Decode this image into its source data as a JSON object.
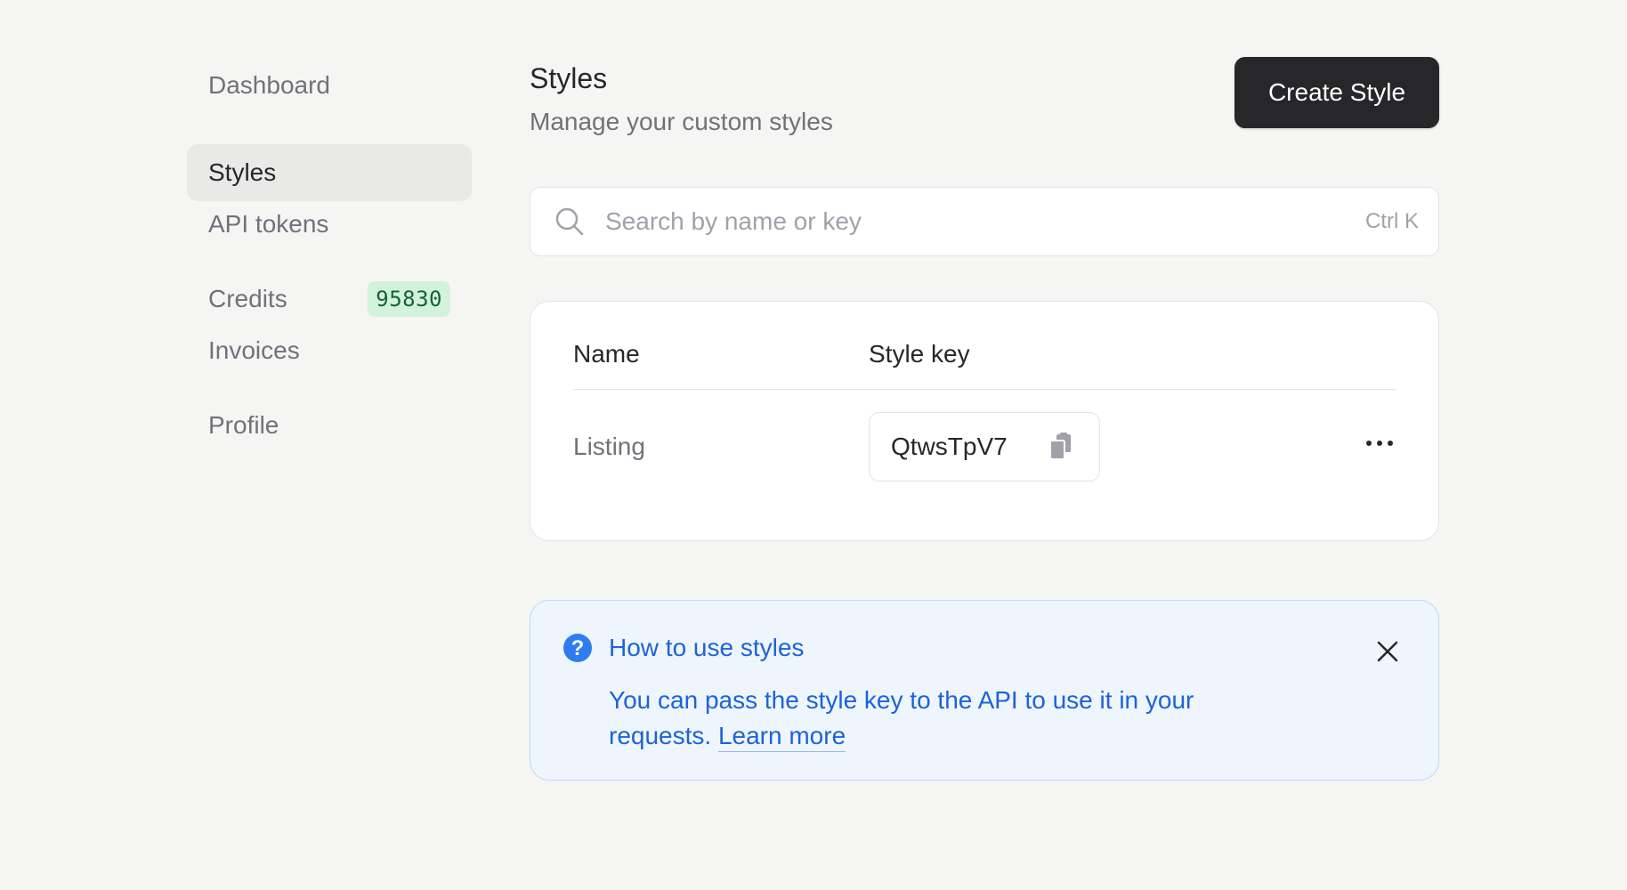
{
  "sidebar": {
    "items": [
      {
        "label": "Dashboard"
      },
      {
        "label": "Styles"
      },
      {
        "label": "API tokens"
      },
      {
        "label": "Credits",
        "badge": "95830"
      },
      {
        "label": "Invoices"
      },
      {
        "label": "Profile"
      }
    ],
    "active": "Styles"
  },
  "header": {
    "title": "Styles",
    "subtitle": "Manage your custom styles",
    "create_label": "Create Style"
  },
  "search": {
    "placeholder": "Search by name or key",
    "shortcut": "Ctrl K",
    "icon": "search-icon"
  },
  "table": {
    "columns": [
      "Name",
      "Style key"
    ],
    "rows": [
      {
        "name": "Listing",
        "key": "QtwsTpV7"
      }
    ]
  },
  "info": {
    "title": "How to use styles",
    "body": "You can pass the style key to the API to use it in your requests.",
    "link": "Learn more"
  },
  "colors": {
    "background": "#f5f5f4",
    "primary_button": "#27272a",
    "badge_bg": "#d3f2dc",
    "badge_text": "#166534",
    "info_bg": "#eef5fd",
    "info_border": "#bdd9f6",
    "info_text": "#1d63d8"
  }
}
